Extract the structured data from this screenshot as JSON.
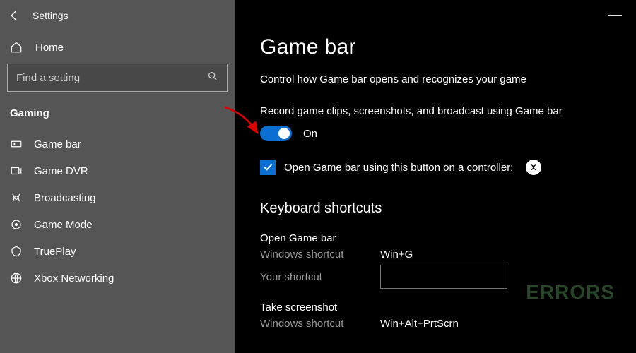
{
  "header": {
    "title": "Settings"
  },
  "home": {
    "label": "Home"
  },
  "search": {
    "placeholder": "Find a setting"
  },
  "category": "Gaming",
  "nav": [
    {
      "label": "Game bar"
    },
    {
      "label": "Game DVR"
    },
    {
      "label": "Broadcasting"
    },
    {
      "label": "Game Mode"
    },
    {
      "label": "TruePlay"
    },
    {
      "label": "Xbox Networking"
    }
  ],
  "page": {
    "title": "Game bar",
    "desc": "Control how Game bar opens and recognizes your game",
    "record_label": "Record game clips, screenshots, and broadcast using Game bar",
    "toggle_state": "On",
    "checkbox_label": "Open Game bar using this button on a controller:",
    "section_shortcuts": "Keyboard shortcuts",
    "shortcuts": [
      {
        "title": "Open Game bar",
        "win_label": "Windows shortcut",
        "win_value": "Win+G",
        "your_label": "Your shortcut"
      },
      {
        "title": "Take screenshot",
        "win_label": "Windows shortcut",
        "win_value": "Win+Alt+PrtScrn"
      }
    ]
  },
  "watermark": "ERRORS"
}
